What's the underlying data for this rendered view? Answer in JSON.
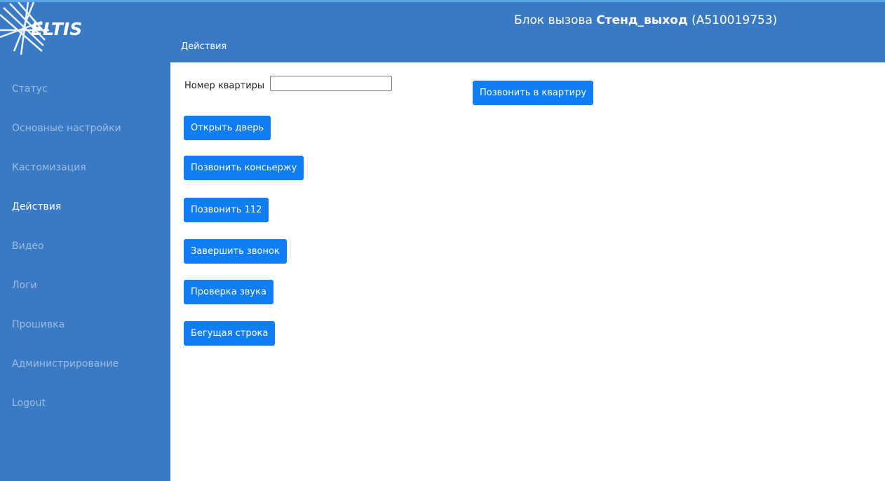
{
  "colors": {
    "sidebar": "#3a7ac4",
    "header": "#3a7ac4",
    "button": "#0f7df4",
    "nav_inactive": "#9fbbe0",
    "nav_active": "#ffffff"
  },
  "logo": {
    "text": "ELTIS"
  },
  "header": {
    "title_prefix": "Блок вызова ",
    "title_name": "Стенд_выход",
    "title_id": " (A510019753)",
    "subtitle": "Действия"
  },
  "sidebar": {
    "items": [
      {
        "label": "Статус"
      },
      {
        "label": "Основные настройки"
      },
      {
        "label": "Кастомизация"
      },
      {
        "label": "Действия",
        "active": true
      },
      {
        "label": "Видео"
      },
      {
        "label": "Логи"
      },
      {
        "label": "Прошивка"
      },
      {
        "label": "Администрирование"
      },
      {
        "label": "Logout"
      }
    ]
  },
  "main": {
    "apartment_label": "Номер квартиры",
    "apartment_value": "",
    "call_apartment": "Позвонить в квартиру",
    "open_door": "Открыть дверь",
    "call_concierge": "Позвонить консьержу",
    "call_112": "Позвонить 112",
    "end_call": "Завершить звонок",
    "sound_check": "Проверка звука",
    "ticker": "Бегущая строка"
  }
}
